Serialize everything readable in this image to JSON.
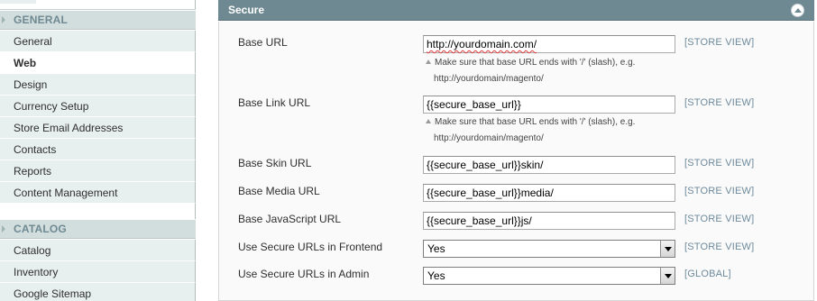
{
  "nav": {
    "groups": [
      {
        "title": "GENERAL",
        "items": [
          {
            "label": "General",
            "active": false
          },
          {
            "label": "Web",
            "active": true
          },
          {
            "label": "Design",
            "active": false
          },
          {
            "label": "Currency Setup",
            "active": false
          },
          {
            "label": "Store Email Addresses",
            "active": false
          },
          {
            "label": "Contacts",
            "active": false
          },
          {
            "label": "Reports",
            "active": false
          },
          {
            "label": "Content Management",
            "active": false
          }
        ]
      },
      {
        "title": "CATALOG",
        "items": [
          {
            "label": "Catalog",
            "active": false
          },
          {
            "label": "Inventory",
            "active": false
          },
          {
            "label": "Google Sitemap",
            "active": false
          }
        ]
      }
    ]
  },
  "section": {
    "title": "Secure",
    "rows": [
      {
        "label": "Base URL",
        "value": "http://yourdomain.com/",
        "scope": "[STORE VIEW]",
        "note": {
          "line1": "Make sure that base URL ends with '/' (slash), e.g.",
          "line2": "http://yourdomain/magento/"
        }
      },
      {
        "label": "Base Link URL",
        "value": "{{secure_base_url}}",
        "scope": "[STORE VIEW]",
        "note": {
          "line1": "Make sure that base URL ends with '/' (slash), e.g.",
          "line2": "http://yourdomain/magento/"
        }
      },
      {
        "label": "Base Skin URL",
        "value": "{{secure_base_url}}skin/",
        "scope": "[STORE VIEW]"
      },
      {
        "label": "Base Media URL",
        "value": "{{secure_base_url}}media/",
        "scope": "[STORE VIEW]"
      },
      {
        "label": "Base JavaScript URL",
        "value": "{{secure_base_url}}js/",
        "scope": "[STORE VIEW]"
      },
      {
        "label": "Use Secure URLs in Frontend",
        "value": "Yes",
        "scope": "[STORE VIEW]"
      },
      {
        "label": "Use Secure URLs in Admin",
        "value": "Yes",
        "scope": "[GLOBAL]"
      }
    ]
  },
  "colors": {
    "section_header": "#6f8992",
    "nav_group_header": "#d1dedd",
    "nav_item_bg": "#e7efef",
    "scope_text": "#6d8a9c"
  },
  "icons": {
    "collapse": "collapse-up-icon",
    "note": "triangle-note-icon",
    "group_arrow": "caret-right-icon"
  }
}
